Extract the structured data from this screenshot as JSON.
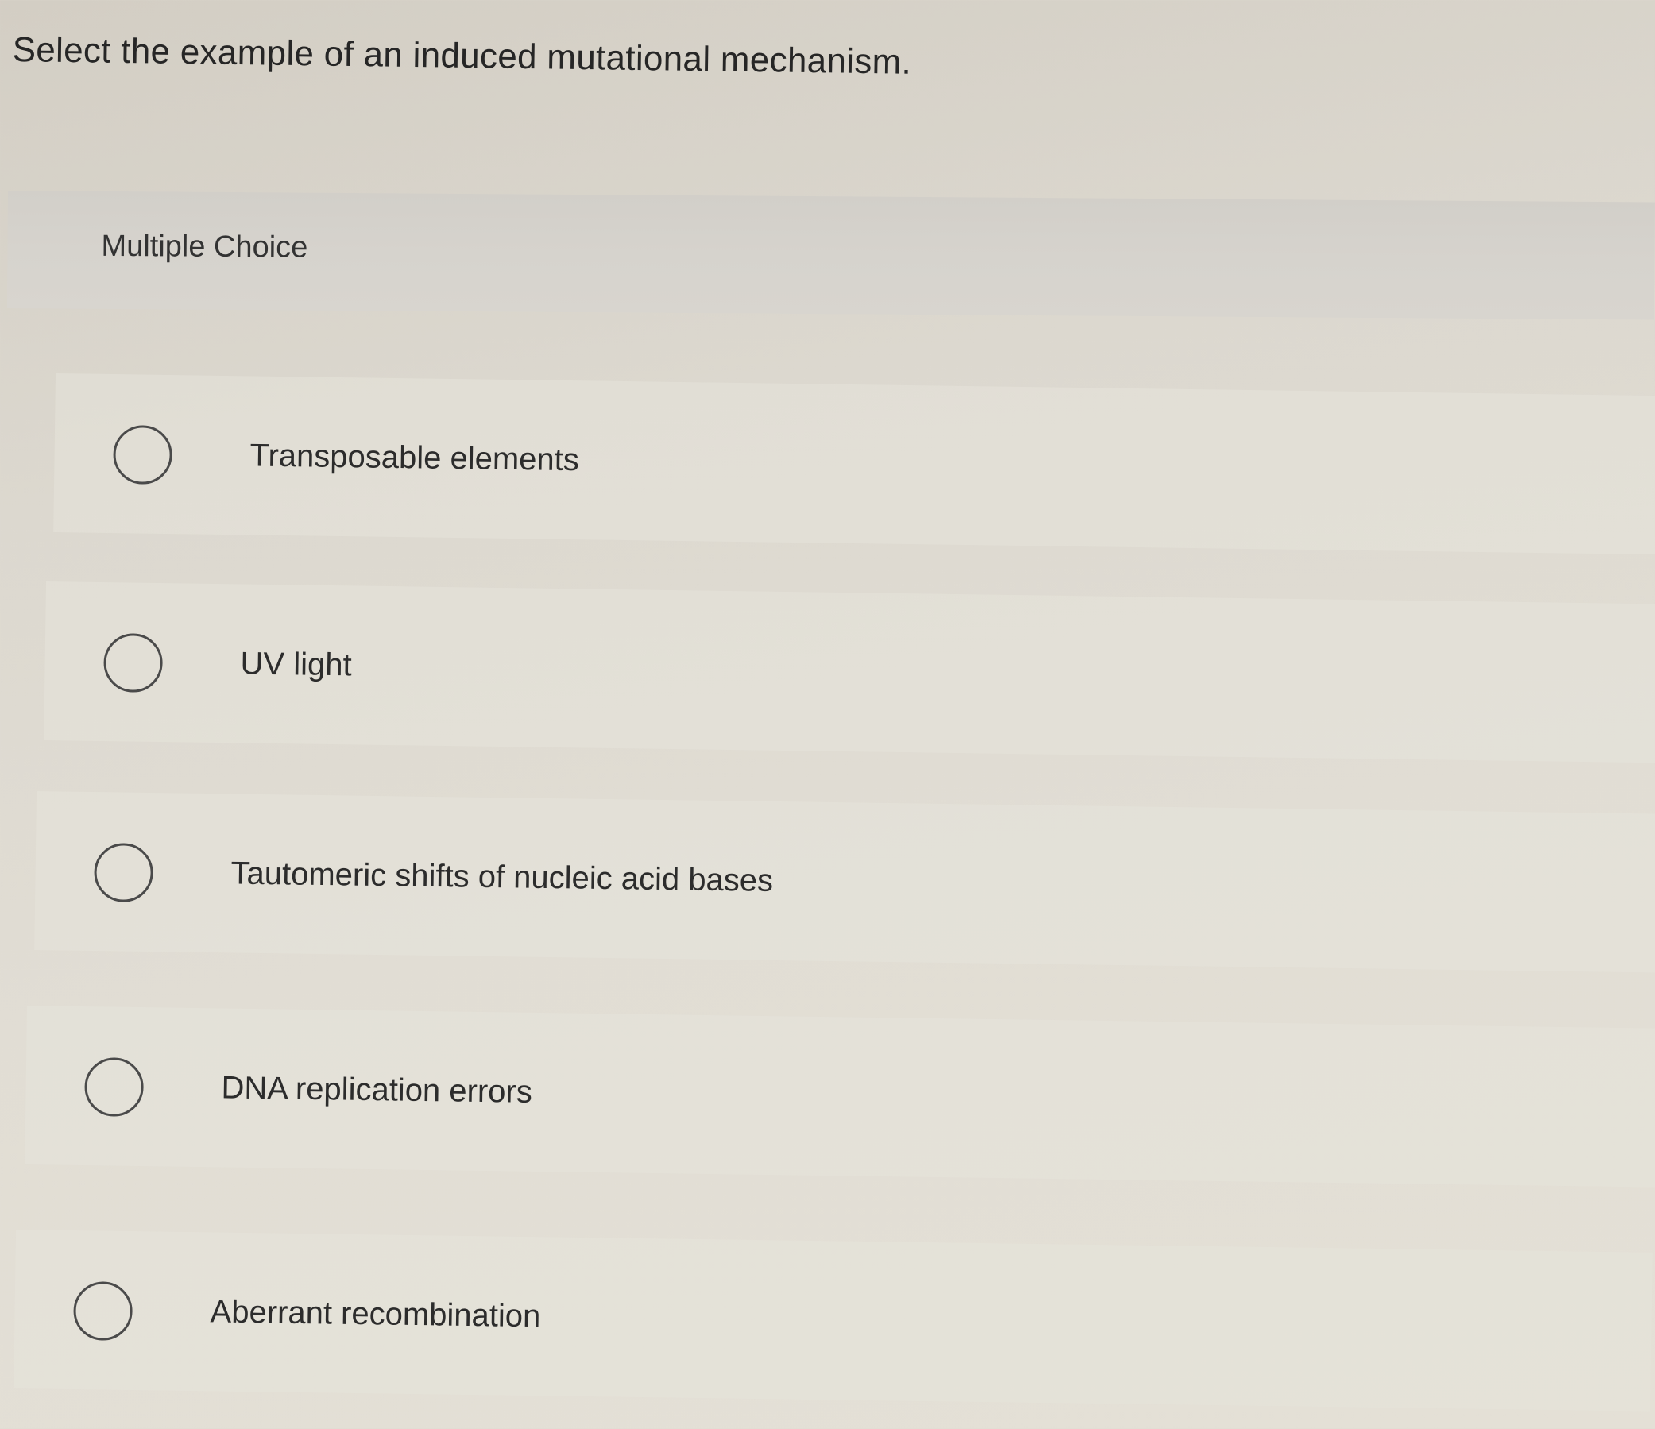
{
  "question": "Select the example of an induced mutational mechanism.",
  "header": {
    "label": "Multiple Choice"
  },
  "options": [
    {
      "label": "Transposable elements"
    },
    {
      "label": "UV light"
    },
    {
      "label": "Tautomeric shifts of nucleic acid bases"
    },
    {
      "label": "DNA replication errors"
    },
    {
      "label": "Aberrant recombination"
    }
  ]
}
